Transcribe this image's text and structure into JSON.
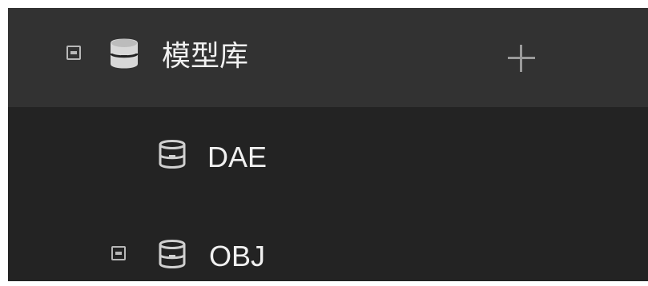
{
  "tree": {
    "root": {
      "label": "模型库",
      "icon": "database-icon",
      "expanded": true
    },
    "children": [
      {
        "label": "DAE",
        "icon": "database-icon"
      },
      {
        "label": "OBJ",
        "icon": "database-icon",
        "expanded": true
      }
    ],
    "add_icon": "plus-icon"
  },
  "colors": {
    "panel_bg": "#232323",
    "selected_row_bg": "#323232",
    "text": "#f0f0f0",
    "icon": "#c8c8c8",
    "tree_line": "#5a5a5a"
  }
}
